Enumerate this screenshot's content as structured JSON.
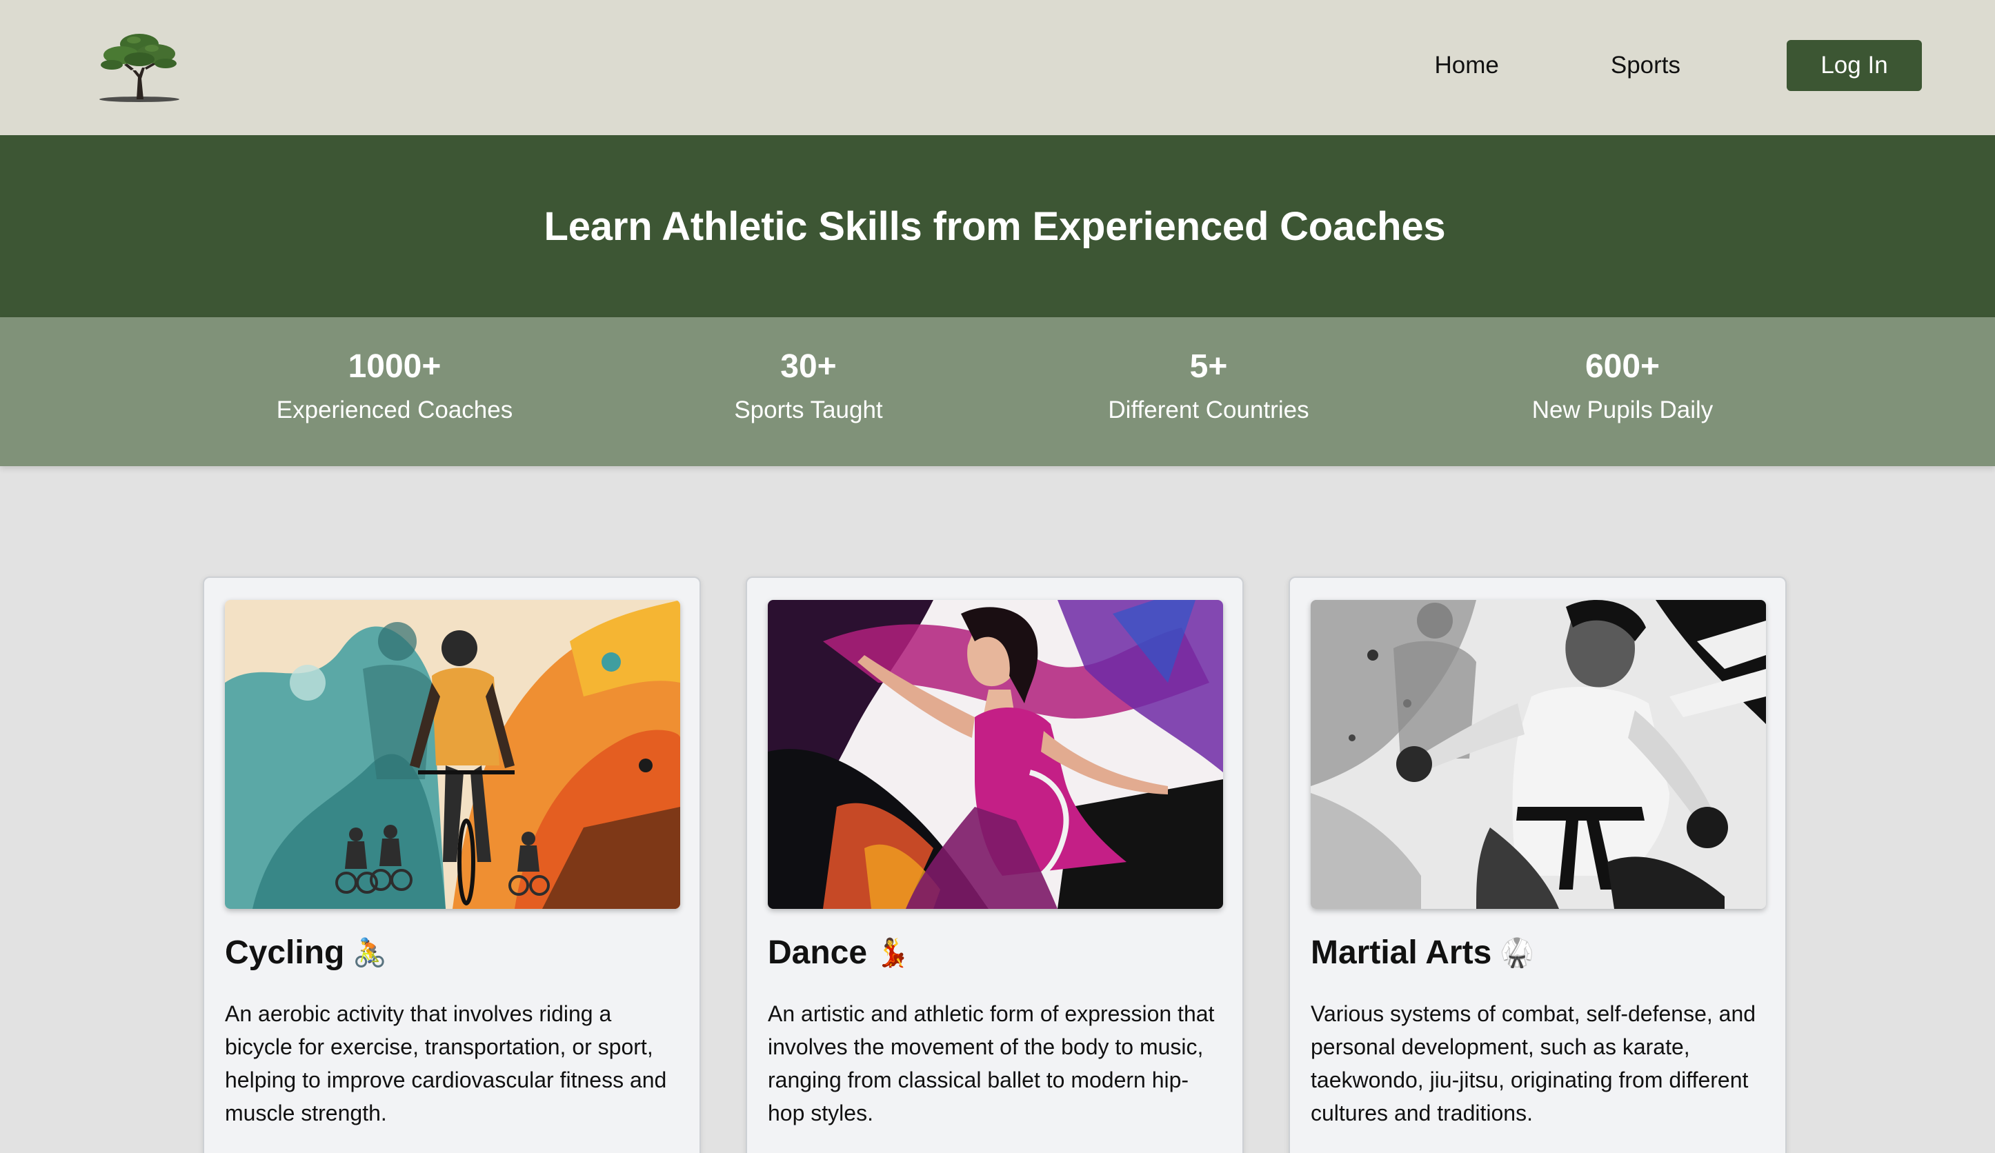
{
  "header": {
    "nav": [
      {
        "label": "Home"
      },
      {
        "label": "Sports"
      }
    ],
    "login_label": "Log In"
  },
  "hero": {
    "title": "Learn Athletic Skills from Experienced Coaches"
  },
  "stats": [
    {
      "value": "1000+",
      "label": "Experienced Coaches"
    },
    {
      "value": "30+",
      "label": "Sports Taught"
    },
    {
      "value": "5+",
      "label": "Different Countries"
    },
    {
      "value": "600+",
      "label": "New Pupils Daily"
    }
  ],
  "cards": [
    {
      "title": "Cycling",
      "emoji": "🚴",
      "description": "An aerobic activity that involves riding a bicycle for exercise, transportation, or sport, helping to improve cardiovascular fitness and muscle strength.",
      "image": "cycling-illustration"
    },
    {
      "title": "Dance",
      "emoji": "💃",
      "description": "An artistic and athletic form of expression that involves the movement of the body to music, ranging from classical ballet to modern hip-hop styles.",
      "image": "dance-illustration"
    },
    {
      "title": "Martial Arts",
      "emoji": "🥋",
      "description": "Various systems of combat, self-defense, and personal development, such as karate, taekwondo, jiu-jitsu, originating from different cultures and traditions.",
      "image": "martial-arts-illustration"
    }
  ],
  "colors": {
    "header_bg": "#dcdbd0",
    "hero_bg": "#3d5634",
    "stats_bg": "#809279",
    "button_bg": "#3c5633",
    "page_bg": "#e2e2e2",
    "card_bg": "#f2f3f5"
  }
}
